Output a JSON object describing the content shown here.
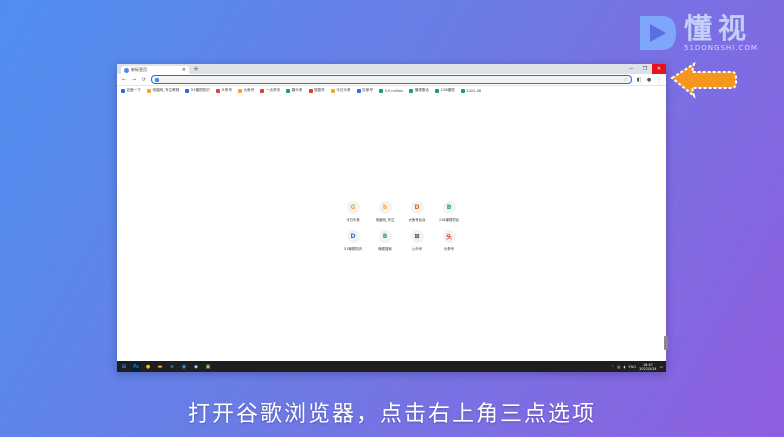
{
  "logo": {
    "cn": "懂视",
    "en": "51DONGSHI.COM"
  },
  "caption": "打开谷歌浏览器，点击右上角三点选项",
  "browser": {
    "tab_title": "新标签页",
    "tab_close": "×",
    "new_tab": "+",
    "win_controls": {
      "min": "—",
      "max": "❐",
      "close": "✕"
    },
    "nav": {
      "back": "←",
      "forward": "→",
      "reload": "⟳"
    },
    "omnibox_placeholder": "",
    "bookmarks": [
      {
        "label": "百度一下",
        "color": "#2b6de3"
      },
      {
        "label": "电脑网_专注教程",
        "color": "#f5a623"
      },
      {
        "label": "51懂视知识",
        "color": "#2b6de3"
      },
      {
        "label": "头条号",
        "color": "#e23b3b"
      },
      {
        "label": "大鱼号",
        "color": "#f5a623"
      },
      {
        "label": "一点资讯",
        "color": "#e23b3b"
      },
      {
        "label": "趣头条",
        "color": "#1aa260"
      },
      {
        "label": "搜狐号",
        "color": "#e23b3b"
      },
      {
        "label": "今日头条",
        "color": "#f5a623"
      },
      {
        "label": "百家号",
        "color": "#2b6de3"
      },
      {
        "label": "3.5 million",
        "color": "#1aa260"
      },
      {
        "label": "懂视集合",
        "color": "#1aa260"
      },
      {
        "label": "218懂视",
        "color": "#1aa260"
      },
      {
        "label": "2022-06",
        "color": "#1aa260"
      }
    ],
    "shortcuts": [
      {
        "label": "今日头条",
        "glyph": "G",
        "color": "#f5a623"
      },
      {
        "label": "电脑网_专注",
        "glyph": "b",
        "color": "#f5a623"
      },
      {
        "label": "大鱼号后台",
        "glyph": "D",
        "color": "#e8610a"
      },
      {
        "label": "218懂视项目",
        "glyph": "B",
        "color": "#1aa260"
      },
      {
        "label": "51懂视知识",
        "glyph": "D",
        "color": "#2b6de3"
      },
      {
        "label": "懂视搜索",
        "glyph": "B",
        "color": "#1aa260"
      },
      {
        "label": "公众号",
        "glyph": "⊞",
        "color": "#333333"
      },
      {
        "label": "头条号",
        "glyph": "头",
        "color": "#e23b3b"
      }
    ]
  },
  "taskbar": {
    "apps": [
      {
        "glyph": "⊞",
        "bg": "transparent",
        "color": "#4aa3ff"
      },
      {
        "glyph": "Ps",
        "bg": "#001e36",
        "color": "#31a8ff"
      },
      {
        "glyph": "●",
        "bg": "transparent",
        "color": "#f5c518"
      },
      {
        "glyph": "▬",
        "bg": "transparent",
        "color": "#e8b84a"
      },
      {
        "glyph": "e",
        "bg": "transparent",
        "color": "#3ea0ff"
      },
      {
        "glyph": "◉",
        "bg": "transparent",
        "color": "#2bb0ff"
      },
      {
        "glyph": "◆",
        "bg": "transparent",
        "color": "#9ad0ff"
      },
      {
        "glyph": "▣",
        "bg": "transparent",
        "color": "#9ae07a"
      }
    ],
    "lang": "ENG",
    "time": "18:47",
    "date": "2022/5/24"
  }
}
